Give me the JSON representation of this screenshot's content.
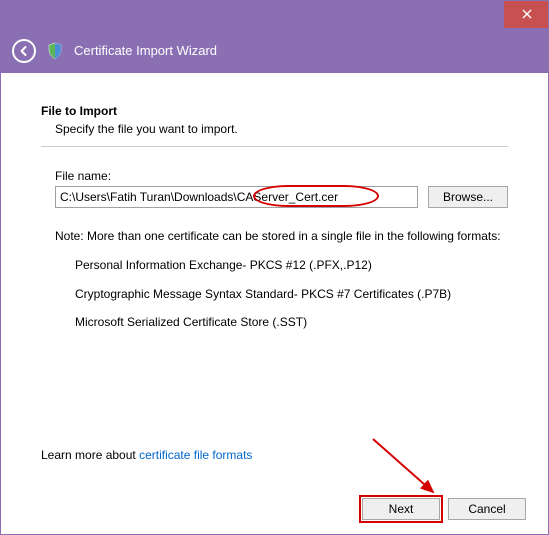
{
  "window": {
    "title": "Certificate Import Wizard"
  },
  "section": {
    "heading": "File to Import",
    "subheading": "Specify the file you want to import."
  },
  "file": {
    "label": "File name:",
    "value": "C:\\Users\\Fatih Turan\\Downloads\\CAServer_Cert.cer",
    "browse": "Browse..."
  },
  "note": {
    "intro": "Note:  More than one certificate can be stored in a single file in the following formats:",
    "items": [
      "Personal Information Exchange- PKCS #12 (.PFX,.P12)",
      "Cryptographic Message Syntax Standard- PKCS #7 Certificates (.P7B)",
      "Microsoft Serialized Certificate Store (.SST)"
    ]
  },
  "learn": {
    "prefix": "Learn more about ",
    "link": "certificate file formats"
  },
  "buttons": {
    "next": "Next",
    "cancel": "Cancel"
  }
}
